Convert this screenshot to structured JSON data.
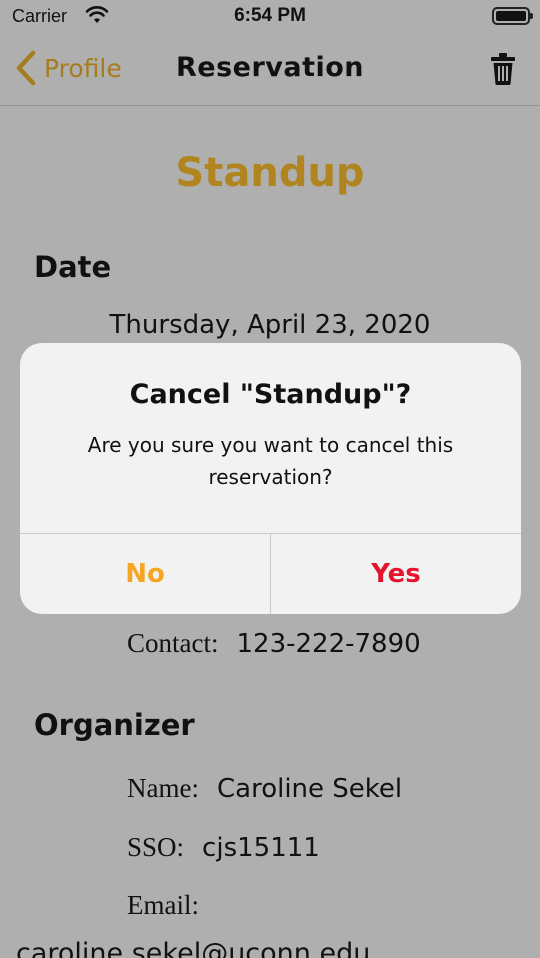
{
  "status_bar": {
    "carrier": "Carrier",
    "time": "6:54 PM"
  },
  "nav": {
    "back_label": "Profile",
    "title": "Reservation"
  },
  "reservation": {
    "name": "Standup",
    "date_heading": "Date",
    "date": "Thursday, April 23, 2020",
    "contact_label": "Contact:",
    "contact_value": "123-222-7890"
  },
  "organizer": {
    "heading": "Organizer",
    "name_label": "Name:",
    "name_value": "Caroline Sekel",
    "sso_label": "SSO:",
    "sso_value": "cjs15111",
    "email_label": "Email:",
    "email_value": "caroline.sekel@uconn.edu"
  },
  "alert": {
    "title": "Cancel \"Standup\"?",
    "message": "Are you sure you want to cancel this reservation?",
    "no_label": "No",
    "yes_label": "Yes"
  },
  "colors": {
    "accent": "#b0851f",
    "no_button": "#f5a623",
    "yes_button": "#e5132b",
    "dimmed_background": "#afafaf"
  },
  "icons": {
    "wifi": "wifi-icon",
    "battery": "battery-icon",
    "back": "chevron-left-icon",
    "trash": "trash-icon"
  }
}
